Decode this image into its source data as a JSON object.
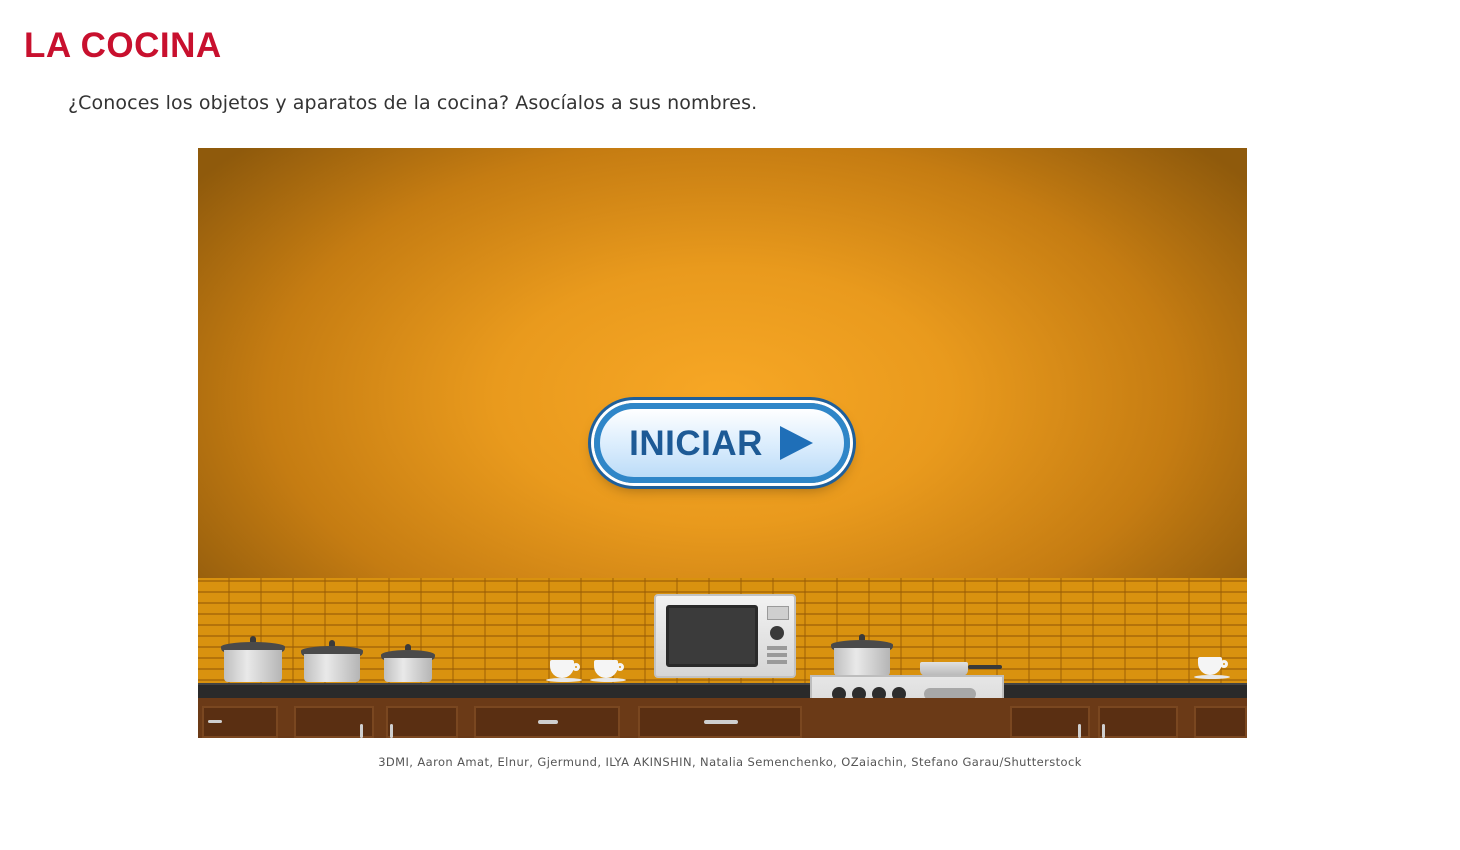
{
  "header": {
    "title": "LA COCINA",
    "instructions": "¿Conoces los objetos y aparatos de la cocina? Asocíalos a sus nombres."
  },
  "activity": {
    "start_button_label": "INICIAR",
    "start_icon": "play-triangle-icon",
    "illustration": [
      "pot",
      "pot",
      "pot",
      "cup",
      "cup",
      "microwave",
      "pot",
      "stove",
      "frying-pan",
      "cup"
    ]
  },
  "credits": "3DMI, Aaron Amat, Elnur, Gjermund, ILYA AKINSHIN, Natalia Semenchenko, OZaiachin, Stefano Garau/Shutterstock",
  "colors": {
    "title": "#c8102e",
    "background_orange": "#f7a725",
    "button_border": "#2f86c8",
    "button_text": "#1d5a96"
  }
}
